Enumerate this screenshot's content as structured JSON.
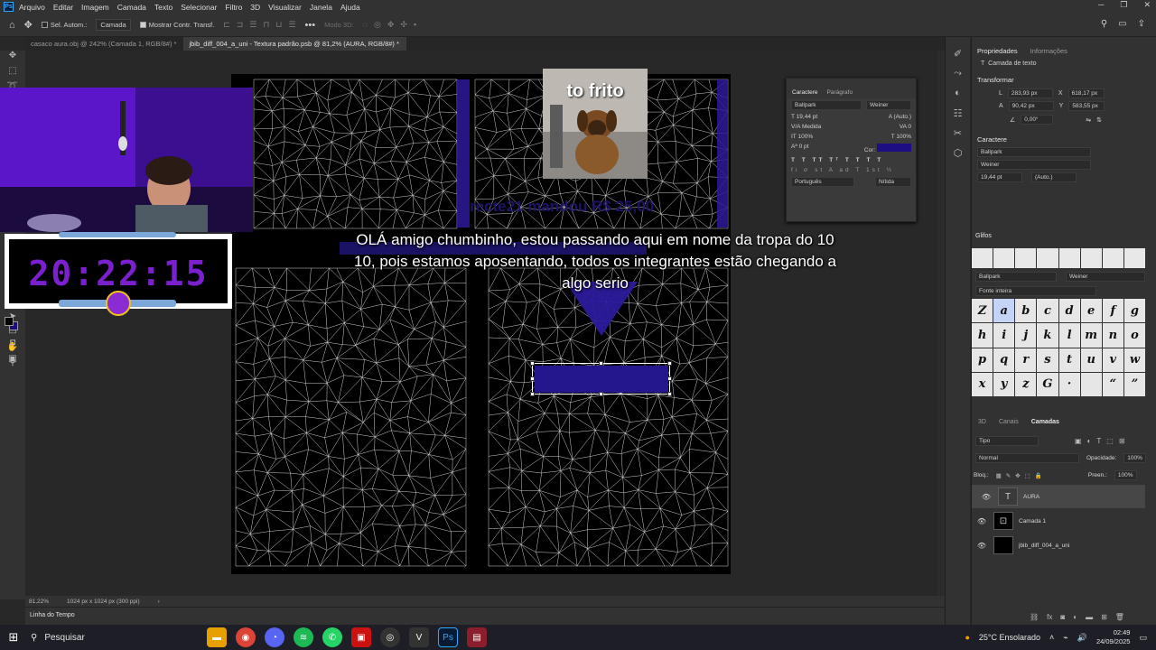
{
  "menu": {
    "app_icon": "Ps",
    "items": [
      "Arquivo",
      "Editar",
      "Imagem",
      "Camada",
      "Texto",
      "Selecionar",
      "Filtro",
      "3D",
      "Visualizar",
      "Janela",
      "Ajuda"
    ]
  },
  "options": {
    "auto_select": "Sel. Autom.:",
    "layer_select": "Camada",
    "show_transform": "Mostrar Contr. Transf.",
    "mode3d": "Modo 3D:"
  },
  "tabs": [
    {
      "label": "casaco aura.obj @ 242% (Camada 1, RGB/8#) *"
    },
    {
      "label": "jbib_diff_004_a_uni - Textura padrão.psb @ 81,2% (AURA, RGB/8#) *"
    }
  ],
  "canvas": {
    "dog_caption": "to frito",
    "ghost_text": "recte21 mandou R$ 25,00",
    "overlay_message": "OLÁ amigo chumbinho, estou passando aqui em nome da tropa do 10 10, pois estamos aposentando, todos os integrantes estão chegando a algo serio"
  },
  "stream": {
    "timer": "20:22:15"
  },
  "status": {
    "zoom": "81,22%",
    "doc_size": "1024 px x 1024 px (300 ppi)"
  },
  "timeline": {
    "label": "Linha do Tempo"
  },
  "character_panel": {
    "tab_char": "Caractere",
    "tab_para": "Parágrafo",
    "font_family": "Ballpark",
    "font_style": "Weiner",
    "size": "19,44 pt",
    "leading": "(Auto.)",
    "kerning": "Medida",
    "tracking": "0",
    "vscale": "100%",
    "hscale": "100%",
    "baseline": "0 pt",
    "color_label": "Cor:",
    "color": "#1d0f83",
    "language": "Português",
    "aa": "Nítida"
  },
  "properties": {
    "tab_props": "Propriedades",
    "tab_info": "Informações",
    "layer_type": "Camada de texto",
    "transform_h": "Transformar",
    "w": "283,93 px",
    "x": "618,17 px",
    "h": "90,42 px",
    "y": "583,55 px",
    "angle": "0,00°",
    "char_h": "Caractere",
    "font_family": "Ballpark",
    "font_style": "Weiner",
    "size": "19,44 pt",
    "leading": "(Auto.)"
  },
  "glyphs": {
    "title": "Glifos",
    "font_family": "Ballpark",
    "font_style": "Weiner",
    "filter": "Fonte inteira",
    "chars": [
      "Z",
      "a",
      "b",
      "c",
      "d",
      "e",
      "f",
      "g",
      "h",
      "i",
      "j",
      "k",
      "l",
      "m",
      "n",
      "o",
      "p",
      "q",
      "r",
      "s",
      "t",
      "u",
      "v",
      "w",
      "x",
      "y",
      "z",
      "G",
      "·",
      "",
      "“",
      "”"
    ]
  },
  "layers": {
    "tab_3d": "3D",
    "tab_channels": "Canais",
    "tab_layers": "Camadas",
    "filter": "Tipo",
    "blend": "Normal",
    "opacity_label": "Opacidade:",
    "opacity": "100%",
    "lock_label": "Bloq.:",
    "fill_label": "Preen.:",
    "fill": "100%",
    "items": [
      {
        "name": "AURA"
      },
      {
        "name": "Camada 1"
      },
      {
        "name": "jbib_diff_004_a_uni"
      }
    ]
  },
  "taskbar": {
    "search": "Pesquisar",
    "weather": "25°C  Ensolarado",
    "time": "02:49",
    "date": "24/09/2025"
  }
}
